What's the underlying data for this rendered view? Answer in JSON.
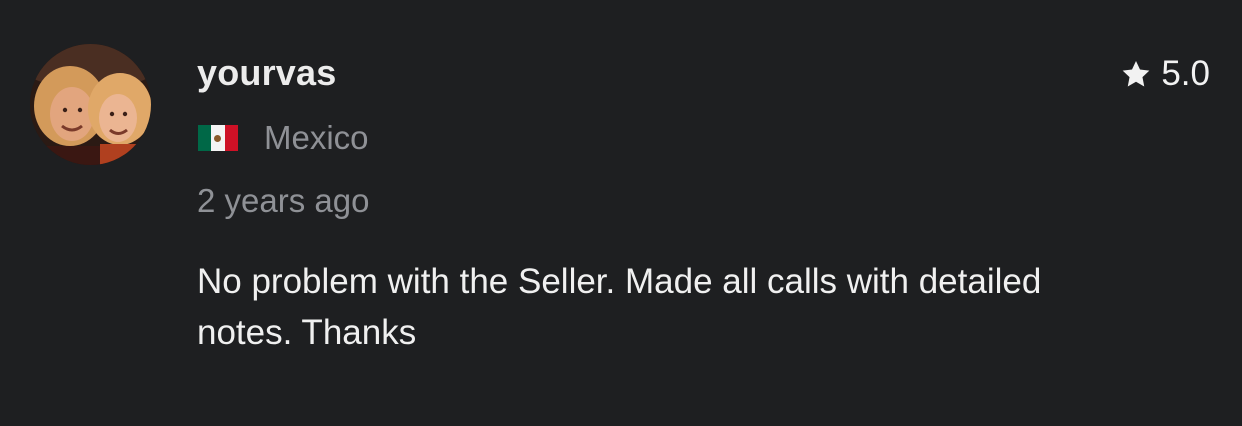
{
  "review": {
    "username": "yourvas",
    "rating": "5.0",
    "country": "Mexico",
    "country_flag": "mexico-flag-icon",
    "posted": "2 years ago",
    "text": "No problem with the Seller. Made all calls with detailed notes. Thanks"
  },
  "colors": {
    "background": "#1e1f21",
    "username": "#ececec",
    "muted": "#8f9196",
    "body": "#f0f0f0"
  }
}
